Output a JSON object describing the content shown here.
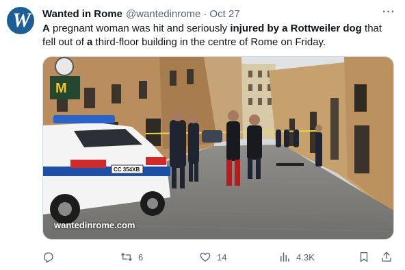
{
  "author": {
    "avatar_letter": "W",
    "name": "Wanted in Rome",
    "handle": "@wantedinrome",
    "separator": "·",
    "date": "Oct 27"
  },
  "more_icon": "more-horizontal-icon",
  "text": {
    "s1": "A",
    "s2": " pregnant woman was hit and seriously ",
    "s3": "injured by a Rottweiler dog",
    "s4": " that fell out of ",
    "s5": "a",
    "s6": " third-floor building in the centre of Rome on Friday."
  },
  "media": {
    "watermark": "wantedinrome.com",
    "plate": "CC 354XB"
  },
  "actions": {
    "reply": {
      "icon": "reply-icon",
      "count": ""
    },
    "retweet": {
      "icon": "retweet-icon",
      "count": "6"
    },
    "like": {
      "icon": "heart-icon",
      "count": "14"
    },
    "views": {
      "icon": "views-icon",
      "count": "4.3K"
    },
    "bookmark": {
      "icon": "bookmark-icon"
    },
    "share": {
      "icon": "share-icon"
    }
  },
  "colors": {
    "secondary_text": "#536471",
    "brand_avatar": "#1d5f94",
    "police_blue": "#1d4fa8"
  }
}
